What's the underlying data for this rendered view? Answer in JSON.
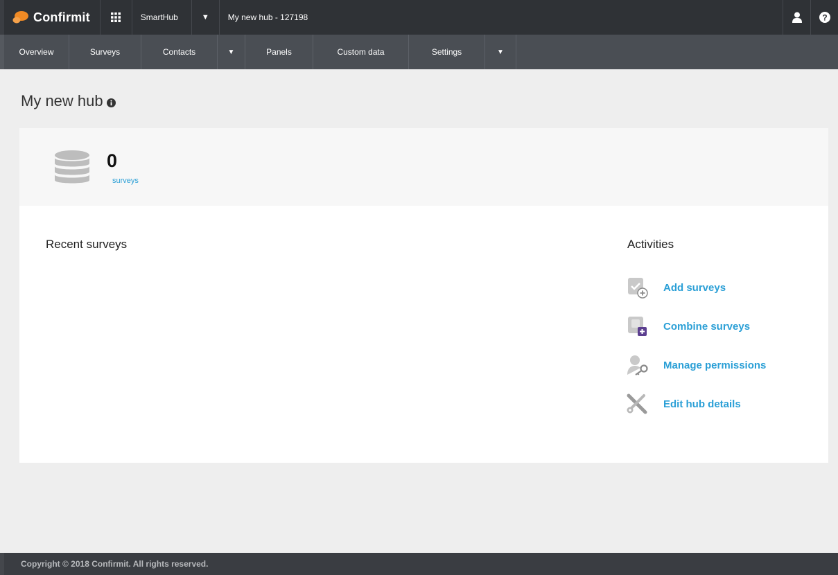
{
  "topbar": {
    "brand": "Confirmit",
    "app_name": "SmartHub",
    "hub_label": "My new hub - 127198"
  },
  "nav": {
    "items": [
      "Overview",
      "Surveys",
      "Contacts",
      "Panels",
      "Custom data",
      "Settings"
    ]
  },
  "page": {
    "title": "My new hub"
  },
  "stats": {
    "count": "0",
    "count_label": "surveys"
  },
  "recent": {
    "title": "Recent surveys"
  },
  "activities": {
    "title": "Activities",
    "items": [
      {
        "label": "Add surveys",
        "icon": "add-survey-icon"
      },
      {
        "label": "Combine surveys",
        "icon": "combine-surveys-icon"
      },
      {
        "label": "Manage permissions",
        "icon": "permissions-key-icon"
      },
      {
        "label": "Edit hub details",
        "icon": "wrench-icon"
      }
    ]
  },
  "footer": {
    "copyright": "Copyright © 2018 Confirmit. All rights reserved."
  },
  "colors": {
    "link": "#2a9fd6",
    "topbar": "#2f3236",
    "navbar": "#4a4e54",
    "brand_orange": "#f08a24"
  }
}
